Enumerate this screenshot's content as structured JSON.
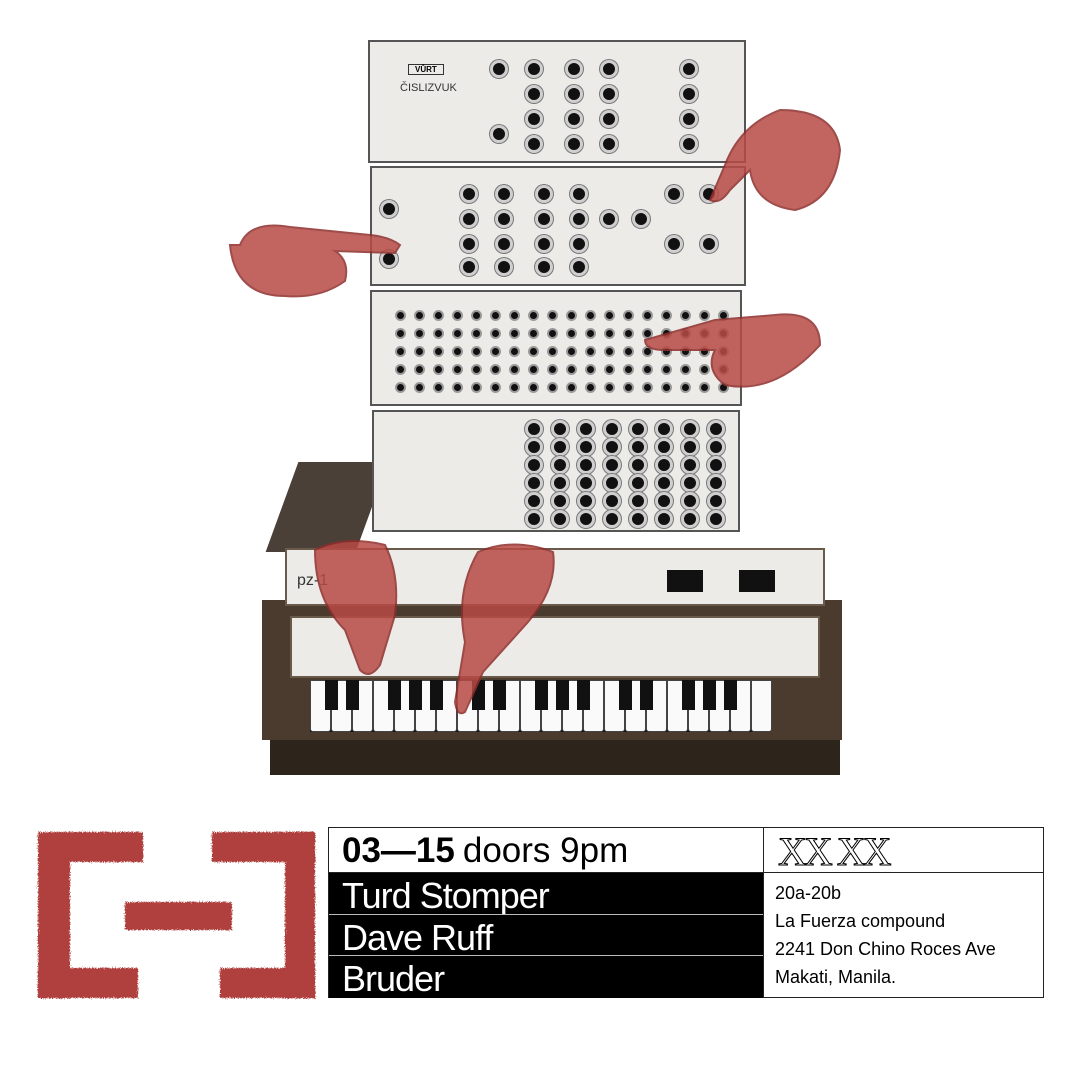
{
  "synth": {
    "brand_badge": "VŮRT",
    "module_name": "ČISLIZVUK",
    "unit_label": "pz-1"
  },
  "event": {
    "date": "03—15",
    "doors": "doors 9pm",
    "acts": [
      "Turd Stomper",
      "Dave Ruff",
      "Bruder"
    ],
    "price": "XX XX",
    "address": [
      "20a-20b",
      "La Fuerza compound",
      "2241 Don Chino Roces Ave",
      "Makati, Manila."
    ]
  },
  "colors": {
    "accent": "#b03f3e",
    "ink": "#000000"
  }
}
